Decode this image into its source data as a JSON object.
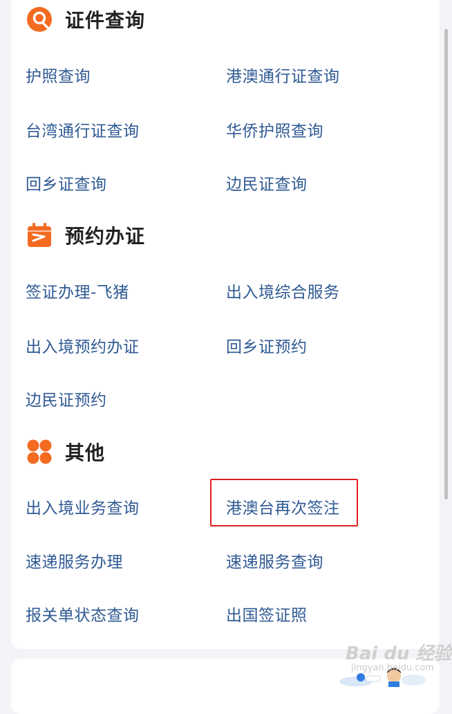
{
  "sections": [
    {
      "title": "证件查询",
      "icon": "search-person-icon",
      "items": [
        [
          "护照查询",
          "港澳通行证查询"
        ],
        [
          "台湾通行证查询",
          "华侨护照查询"
        ],
        [
          "回乡证查询",
          "边民证查询"
        ]
      ]
    },
    {
      "title": "预约办证",
      "icon": "calendar-icon",
      "items": [
        [
          "签证办理-飞猪",
          "出入境综合服务"
        ],
        [
          "出入境预约办证",
          "回乡证预约"
        ],
        [
          "边民证预约",
          ""
        ]
      ]
    },
    {
      "title": "其他",
      "icon": "grid-icon",
      "items": [
        [
          "出入境业务查询",
          "港澳台再次签注"
        ],
        [
          "速递服务办理",
          "速递服务查询"
        ],
        [
          "报关单状态查询",
          "出国签证照"
        ]
      ]
    }
  ],
  "watermark": {
    "main": "Bai du 经验",
    "sub": "jingyan.baidu.com"
  },
  "colors": {
    "accent": "#f36b21",
    "link": "#2f5a93",
    "highlight": "#e02020"
  }
}
